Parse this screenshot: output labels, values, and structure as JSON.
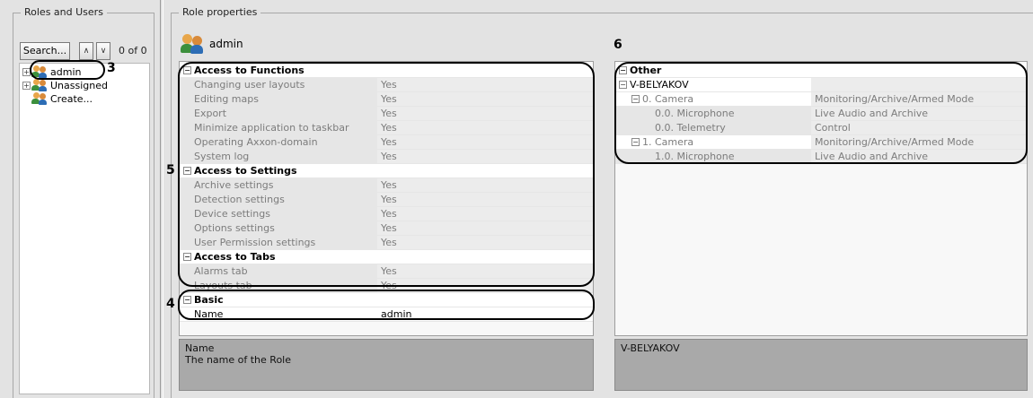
{
  "roles_panel": {
    "title": "Roles and Users",
    "search_label": "Search...",
    "prev_label": "∧",
    "next_label": "∨",
    "match_count": "0 of 0",
    "tree": [
      {
        "label": "admin",
        "icon": "role-icon"
      },
      {
        "label": "Unassigned",
        "icon": "role-icon"
      },
      {
        "label": "Create...",
        "icon": "role-icon"
      }
    ]
  },
  "props_panel": {
    "title": "Role properties",
    "role_name": "admin",
    "left_grid": {
      "access_functions": {
        "label": "Access to Functions",
        "items": [
          {
            "name": "Changing user layouts",
            "value": "Yes"
          },
          {
            "name": "Editing maps",
            "value": "Yes"
          },
          {
            "name": "Export",
            "value": "Yes"
          },
          {
            "name": "Minimize application to taskbar",
            "value": "Yes"
          },
          {
            "name": "Operating Axxon-domain",
            "value": "Yes"
          },
          {
            "name": "System log",
            "value": "Yes"
          }
        ]
      },
      "access_settings": {
        "label": "Access to Settings",
        "items": [
          {
            "name": "Archive settings",
            "value": "Yes"
          },
          {
            "name": "Detection settings",
            "value": "Yes"
          },
          {
            "name": "Device settings",
            "value": "Yes"
          },
          {
            "name": "Options settings",
            "value": "Yes"
          },
          {
            "name": "User Permission settings",
            "value": "Yes"
          }
        ]
      },
      "access_tabs": {
        "label": "Access to Tabs",
        "items": [
          {
            "name": "Alarms tab",
            "value": "Yes"
          },
          {
            "name": "Layouts tab",
            "value": "Yes"
          }
        ]
      },
      "basic": {
        "label": "Basic",
        "items": [
          {
            "name": "Name",
            "value": "admin"
          }
        ]
      }
    },
    "left_description": {
      "title": "Name",
      "text": "The name of the Role"
    },
    "right_grid": {
      "category": "Other",
      "server": "V-BELYAKOV",
      "rows": [
        {
          "name": "0. Camera",
          "value": "Monitoring/Archive/Armed Mode"
        },
        {
          "name": "0.0. Microphone",
          "value": "Live Audio and Archive"
        },
        {
          "name": "0.0. Telemetry",
          "value": "Control"
        },
        {
          "name": "1. Camera",
          "value": "Monitoring/Archive/Armed Mode"
        },
        {
          "name": "1.0. Microphone",
          "value": "Live Audio and Archive"
        }
      ]
    },
    "right_description": {
      "title": "V-BELYAKOV"
    }
  },
  "annotations": [
    "3",
    "4",
    "5",
    "6"
  ],
  "colors": {
    "background": "#e3e3e3",
    "category_row": "#ffffff",
    "disabled_text": "#7c7c7c",
    "description_panel": "#a9a9a9"
  }
}
